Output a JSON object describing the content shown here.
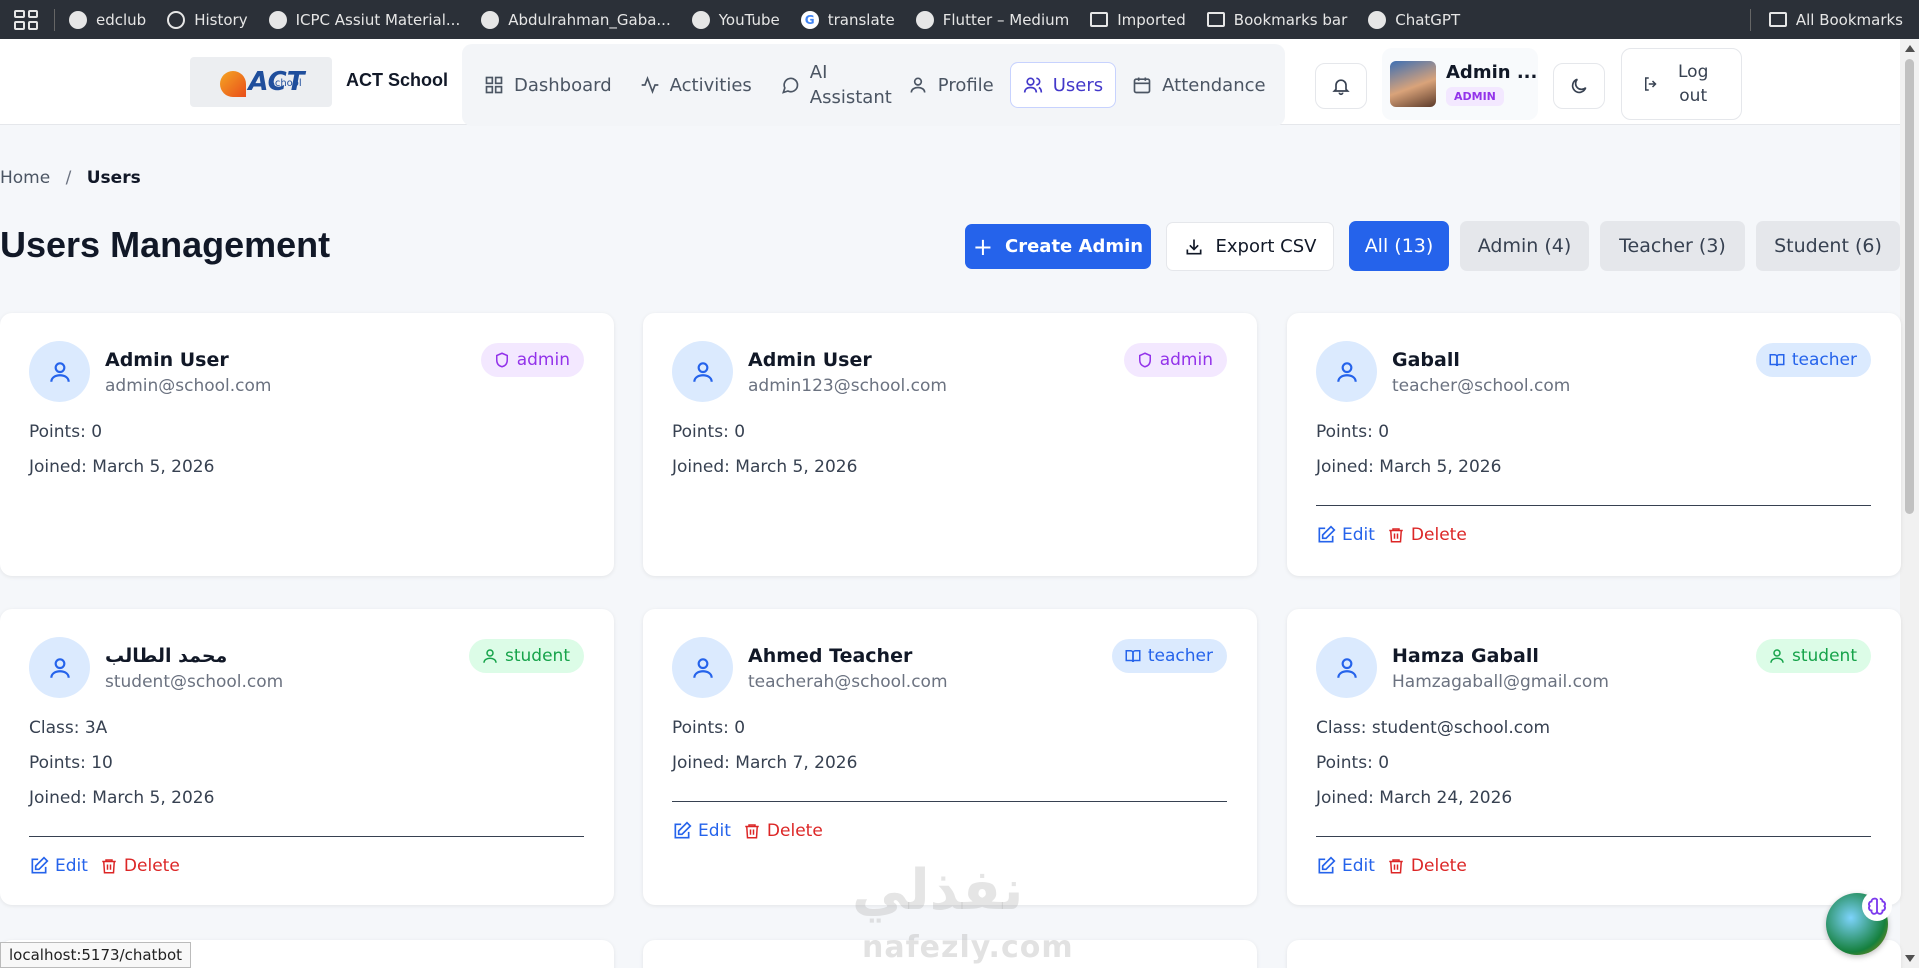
{
  "bookmarks": {
    "items": [
      {
        "label": "edclub",
        "icon": "globe-icon"
      },
      {
        "label": "History",
        "icon": "clock-icon"
      },
      {
        "label": "ICPC Assiut Material...",
        "icon": "globe-icon"
      },
      {
        "label": "Abdulrahman_Gaba...",
        "icon": "globe-icon"
      },
      {
        "label": "YouTube",
        "icon": "globe-icon"
      },
      {
        "label": "translate",
        "icon": "google-icon"
      },
      {
        "label": "Flutter – Medium",
        "icon": "globe-icon"
      },
      {
        "label": "Imported",
        "icon": "folder-icon"
      },
      {
        "label": "Bookmarks bar",
        "icon": "folder-icon"
      },
      {
        "label": "ChatGPT",
        "icon": "chatgpt-icon"
      }
    ],
    "all_bookmarks": "All Bookmarks"
  },
  "header": {
    "brand": "ACT School",
    "logo_text": "ACT",
    "logo_sub": "School",
    "nav": [
      {
        "label": "Dashboard",
        "icon": "grid-icon"
      },
      {
        "label": "Activities",
        "icon": "activity-icon"
      },
      {
        "label": "AI Assistant",
        "icon": "chat-icon"
      },
      {
        "label": "Profile",
        "icon": "user-icon"
      },
      {
        "label": "Users",
        "icon": "users-icon",
        "active": true
      },
      {
        "label": "Attendance",
        "icon": "calendar-icon"
      }
    ],
    "user_name": "Admin ...",
    "user_role": "ADMIN",
    "logout_line1": "Log",
    "logout_line2": "out"
  },
  "breadcrumb": {
    "home": "Home",
    "separator": "/",
    "current": "Users"
  },
  "page_title": "Users Management",
  "toolbar": {
    "create_admin": "Create Admin",
    "export_csv": "Export CSV",
    "filters": [
      {
        "label": "All (13)",
        "active": true
      },
      {
        "label": "Admin (4)",
        "active": false
      },
      {
        "label": "Teacher (3)",
        "active": false
      },
      {
        "label": "Student (6)",
        "active": false
      }
    ]
  },
  "actions": {
    "edit": "Edit",
    "delete": "Delete"
  },
  "users": [
    {
      "name": "Admin User",
      "email": "admin@school.com",
      "role": "admin",
      "class": "",
      "points": "Points: 0",
      "joined": "Joined: March 5, 2026",
      "editable": false
    },
    {
      "name": "Admin User",
      "email": "admin123@school.com",
      "role": "admin",
      "class": "",
      "points": "Points: 0",
      "joined": "Joined: March 5, 2026",
      "editable": false
    },
    {
      "name": "Gaball",
      "email": "teacher@school.com",
      "role": "teacher",
      "class": "",
      "points": "Points: 0",
      "joined": "Joined: March 5, 2026",
      "editable": true
    },
    {
      "name": "محمد الطالب",
      "email": "student@school.com",
      "role": "student",
      "class": "Class: 3A",
      "points": "Points: 10",
      "joined": "Joined: March 5, 2026",
      "editable": true
    },
    {
      "name": "Ahmed Teacher",
      "email": "teacherah@school.com",
      "role": "teacher",
      "class": "",
      "points": "Points: 0",
      "joined": "Joined: March 7, 2026",
      "editable": true
    },
    {
      "name": "Hamza Gaball",
      "email": "Hamzagaball@gmail.com",
      "role": "student",
      "class": "Class: student@school.com",
      "points": "Points: 0",
      "joined": "Joined: March 24, 2026",
      "editable": true
    }
  ],
  "watermark": {
    "arabic": "نفذلي",
    "latin": "nafezly.com"
  },
  "status_url": "localhost:5173/chatbot"
}
